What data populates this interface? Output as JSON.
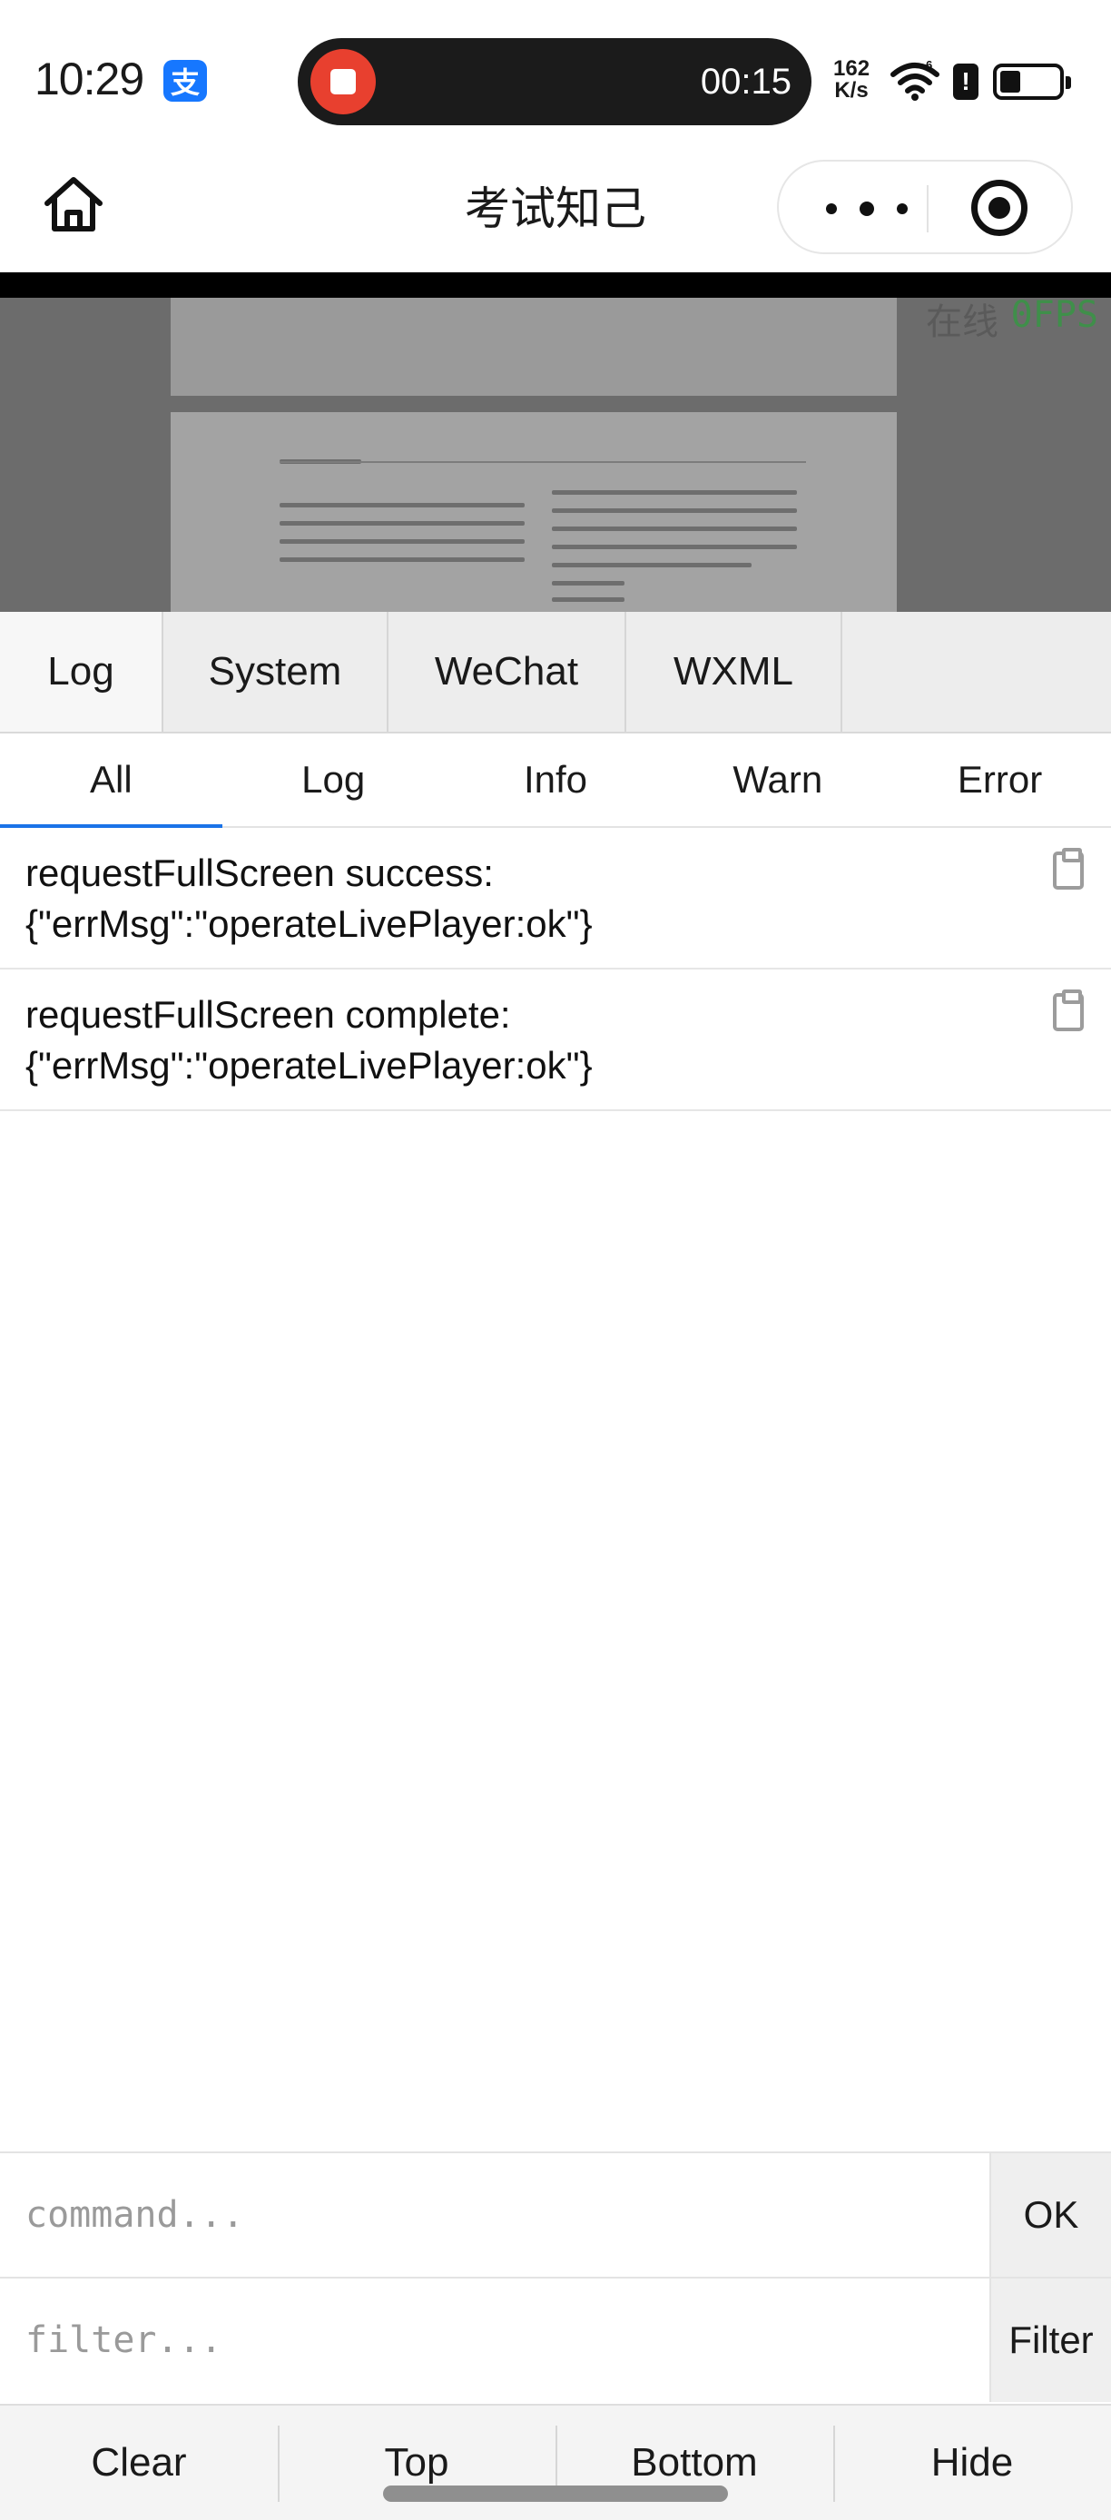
{
  "status_bar": {
    "time": "10:29",
    "alipay_glyph": "支",
    "recording_time": "00:15",
    "net_speed_value": "162",
    "net_speed_unit": "K/s",
    "signal_label": "6",
    "icons": [
      "alipay-icon",
      "record-stop-icon",
      "wifi-icon",
      "alert-icon",
      "battery-icon"
    ]
  },
  "title_bar": {
    "title": "考试知己",
    "icons": [
      "home-icon",
      "more-icon",
      "target-icon"
    ]
  },
  "video": {
    "online_text": "在线",
    "fps_text": "0FPS"
  },
  "vconsole": {
    "tabs": [
      {
        "label": "Log",
        "active": true
      },
      {
        "label": "System",
        "active": false
      },
      {
        "label": "WeChat",
        "active": false
      },
      {
        "label": "WXML",
        "active": false
      }
    ],
    "filters": [
      {
        "label": "All",
        "active": true
      },
      {
        "label": "Log",
        "active": false
      },
      {
        "label": "Info",
        "active": false
      },
      {
        "label": "Warn",
        "active": false
      },
      {
        "label": "Error",
        "active": false
      }
    ],
    "logs": [
      {
        "line1": "requestFullScreen success:",
        "line2": "{\"errMsg\":\"operateLivePlayer:ok\"}"
      },
      {
        "line1": "requestFullScreen complete:",
        "line2": "{\"errMsg\":\"operateLivePlayer:ok\"}"
      }
    ],
    "command": {
      "placeholder": "command...",
      "button": "OK"
    },
    "filter": {
      "placeholder": "filter...",
      "button": "Filter"
    },
    "toolbar": [
      "Clear",
      "Top",
      "Bottom",
      "Hide"
    ]
  },
  "colors": {
    "accent": "#1a73e8",
    "record": "#e8402f",
    "fps": "#3f8f4a",
    "alipay": "#1677ff"
  }
}
